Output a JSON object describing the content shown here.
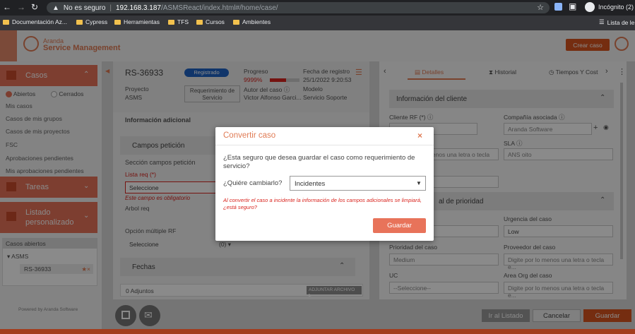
{
  "browser": {
    "not_secure": "No es seguro",
    "url_host": "192.168.3.187",
    "url_path": "/ASMSReact/index.html#/home/case/",
    "profile": "Incógnito (2)",
    "bookmarks": [
      "Documentación Az...",
      "Cypress",
      "Herramientas",
      "TFS",
      "Cursos",
      "Ambientes"
    ],
    "reading_list": "Lista de le"
  },
  "app": {
    "brand_top": "Aranda",
    "brand_bottom": "Service Management",
    "create_case": "Crear caso"
  },
  "sidebar": {
    "cases": "Casos",
    "open": "Abiertos",
    "closed": "Cerrados",
    "links": [
      "Mis casos",
      "Casos de mis grupos",
      "Casos de mis proyectos",
      "FSC",
      "Aprobaciones pendientes",
      "Mis aprobaciones pendientes"
    ],
    "tasks": "Tareas",
    "custom_list": "Listado personalizado",
    "open_cases": "Casos abiertos",
    "project": "ASMS",
    "case_item": "RS-36933",
    "powered": "Powered by Aranda Software"
  },
  "case": {
    "id": "RS-36933",
    "status": "Registrado",
    "progress_label": "Progreso",
    "progress_value": "9999%",
    "progress_fraction": 0.55,
    "date_label": "Fecha de registro",
    "date_value": "25/1/2022 9:20:53",
    "project_label": "Proyecto",
    "project_value": "ASMS",
    "type_value": "Requerimiento de Servicio",
    "author_label": "Autor del caso",
    "author_value": "Victor Alfonso Garci...",
    "model_label": "Modelo",
    "model_value": "Servicio Soporte",
    "additional_info": "Información adicional",
    "fields_section": "Campos petición",
    "fields_subsection": "Sección campos petición",
    "list_label": "Lista req (*)",
    "list_value": "Seleccione",
    "required_msg": "Este campo es obligatorio",
    "tree_label": "Arbol req",
    "multi_label": "Opción múltiple RF",
    "multi_value": "Seleccione",
    "multi_count": "(0)",
    "dates": "Fechas",
    "attachments": "0 Adjuntos",
    "attach_button": "ADJUNTAR ARCHIVO"
  },
  "right": {
    "tabs": [
      "Detalles",
      "Historial",
      "Tiempos Y Cost"
    ],
    "client_info": "Información del cliente",
    "client_rf": "Cliente RF (*)",
    "client_placeholder": "Digite por lo menos una letra o tecla e...",
    "company": "Compañía asociada",
    "company_value": "Aranda Software",
    "sla": "SLA",
    "sla_value": "ANS oito",
    "priority_section": "al de prioridad",
    "urgency": "Urgencia del caso",
    "urgency_value": "Low",
    "priority": "Prioridad del caso",
    "priority_value": "Medium",
    "provider": "Proveedor del caso",
    "provider_placeholder": "Digite por lo menos una letra o tecla e...",
    "uc": "UC",
    "uc_value": "--Seleccione--",
    "area": "Area Org del caso",
    "area_placeholder": "Digite por lo menos una letra o tecla e..."
  },
  "footer": {
    "back": "Ir al Listado",
    "cancel": "Cancelar",
    "save": "Guardar"
  },
  "modal": {
    "title": "Convertir caso",
    "question": "¿Esta seguro que desea guardar el caso como requerimiento de servicio?",
    "change_label": "¿Quiére cambiarlo?",
    "change_value": "Incidentes",
    "warning": "Al convertir el caso a incidente la información de los campos adicionales se limpiará, ¿está seguro?",
    "save": "Guardar"
  },
  "colors": {
    "accent": "#e8735a",
    "accent_dark": "#d9541e",
    "status_blue": "#1e63c4"
  }
}
